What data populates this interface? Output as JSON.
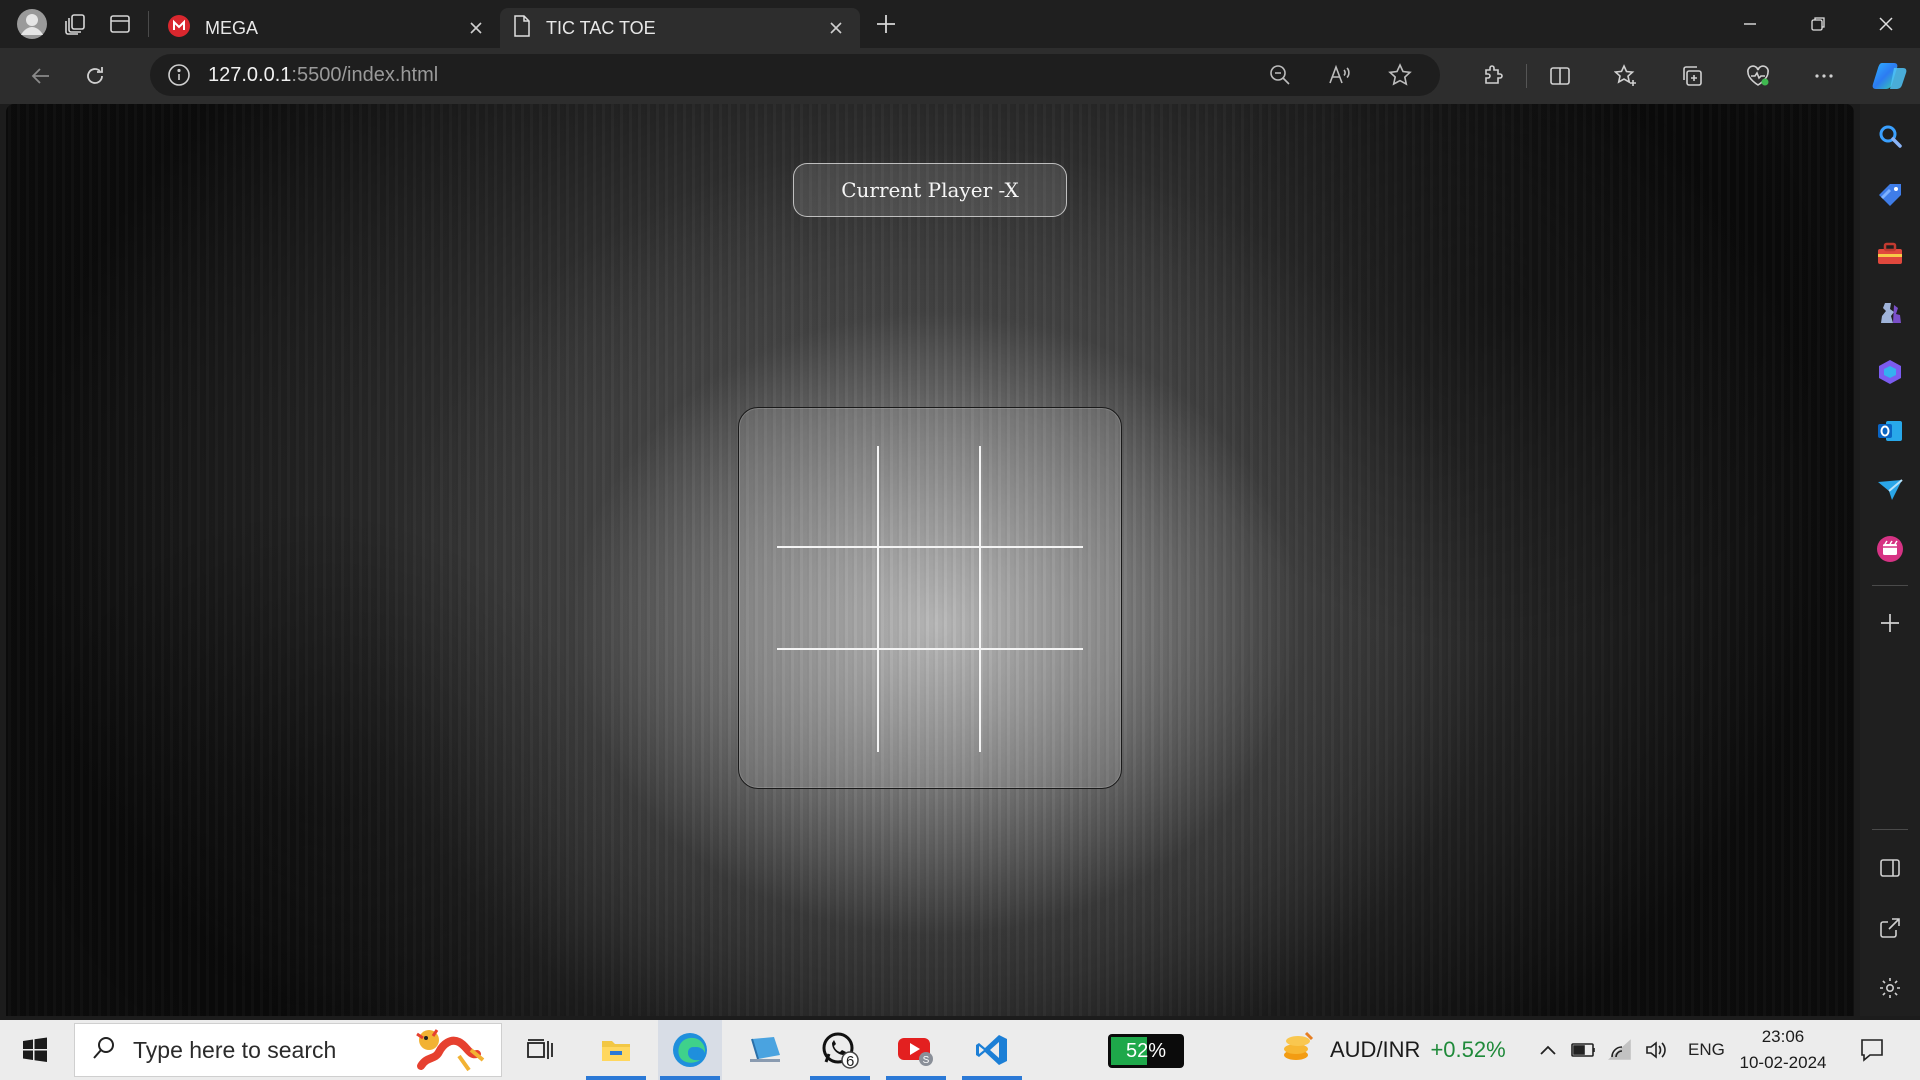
{
  "browser": {
    "tabs": [
      {
        "title": "MEGA",
        "favicon": "mega-icon",
        "active": false
      },
      {
        "title": "TIC TAC TOE",
        "favicon": "page-icon",
        "active": true
      }
    ],
    "url": {
      "host": "127.0.0.1",
      "path": ":5500/index.html"
    },
    "colors": {
      "chrome_dark": "#1f1f1f",
      "tab_active": "#2d2d2d",
      "mega_red": "#d9272e"
    }
  },
  "page": {
    "status_text": "Current Player -X",
    "board": [
      "",
      "",
      "",
      "",
      "",
      "",
      "",
      "",
      ""
    ]
  },
  "sidebar": {
    "icons": [
      "search-icon",
      "shopping-tag-icon",
      "toolbox-icon",
      "games-icon",
      "copilot-icon",
      "outlook-icon",
      "send-icon",
      "video-icon",
      "add-icon",
      "sidebar-toggle-icon",
      "open-external-icon",
      "settings-icon"
    ]
  },
  "taskbar": {
    "search_placeholder": "Type here to search",
    "battery_percent_label": "52%",
    "battery_percent": 52,
    "whatsapp_badge": "6",
    "ticker": {
      "symbol": "AUD/INR",
      "change": "+0.52%"
    },
    "language": "ENG",
    "time": "23:06",
    "date": "10-02-2024"
  }
}
